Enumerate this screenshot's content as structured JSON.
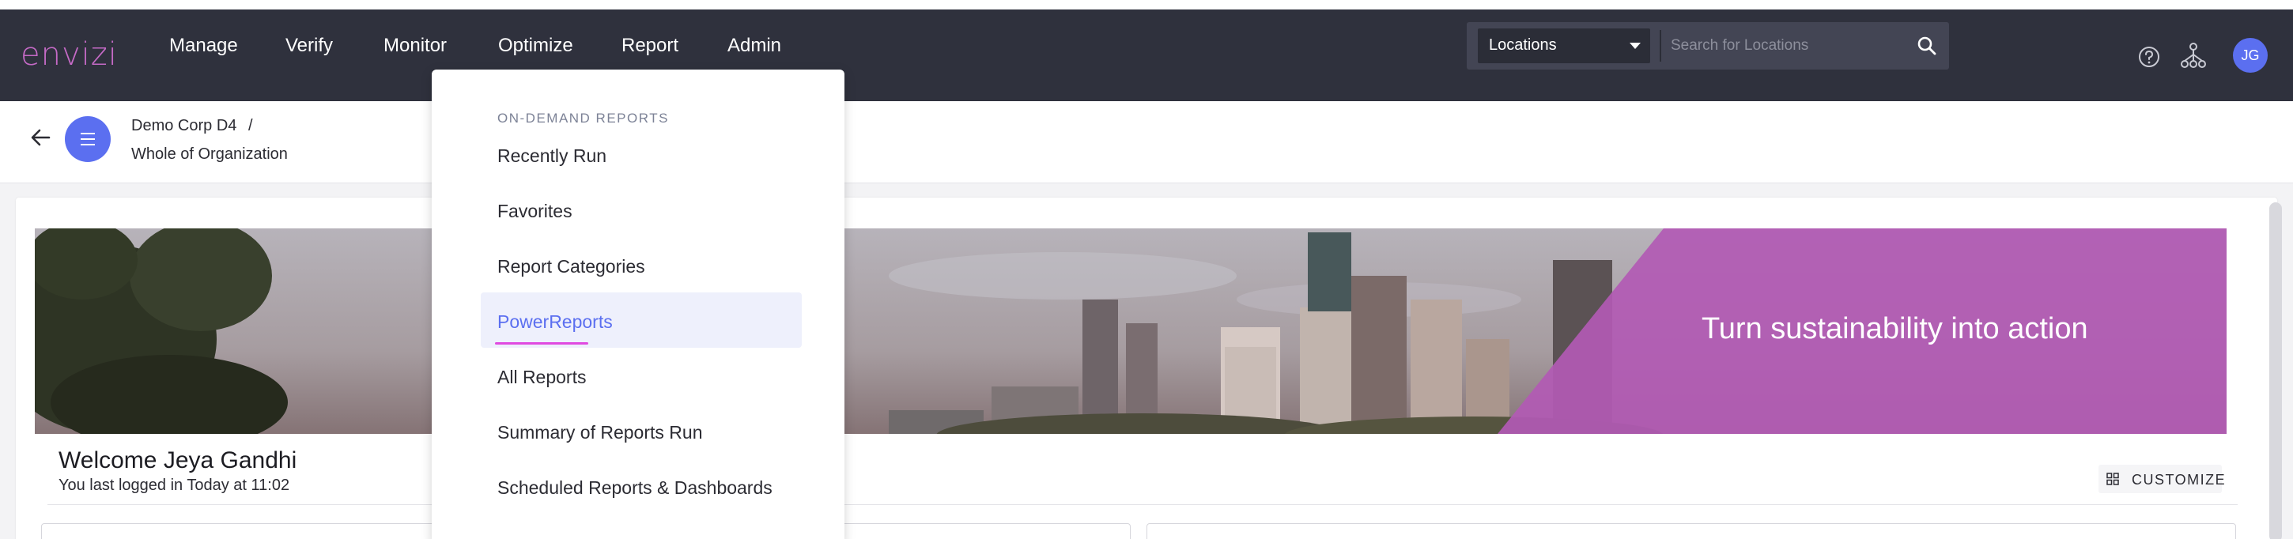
{
  "app": {
    "logo": "envizi"
  },
  "nav": {
    "items": [
      "Manage",
      "Verify",
      "Monitor",
      "Optimize",
      "Report",
      "Admin"
    ],
    "active": "Report"
  },
  "search": {
    "location_type": "Locations",
    "placeholder": "Search for Locations"
  },
  "user": {
    "initials": "JG"
  },
  "breadcrumb": {
    "organization": "Demo Corp D4",
    "separator": "/",
    "scope": "Whole of Organization"
  },
  "banner": {
    "tagline": "Turn sustainability into action"
  },
  "welcome": {
    "title": "Welcome Jeya Gandhi",
    "last_login": "You last logged in Today at 11:02"
  },
  "customize": {
    "label": "CUSTOMIZE"
  },
  "report_menu": {
    "heading": "ON-DEMAND REPORTS",
    "items": [
      "Recently Run",
      "Favorites",
      "Report Categories",
      "PowerReports",
      "All Reports",
      "Summary of Reports Run",
      "Scheduled Reports & Dashboards"
    ],
    "active": "PowerReports"
  },
  "colors": {
    "nav_bg": "#2f313d",
    "accent_magenta": "#e04ae0",
    "logo": "#c56ac6",
    "primary_blue": "#5b6ff0",
    "banner_overlay": "#b25ab4"
  }
}
